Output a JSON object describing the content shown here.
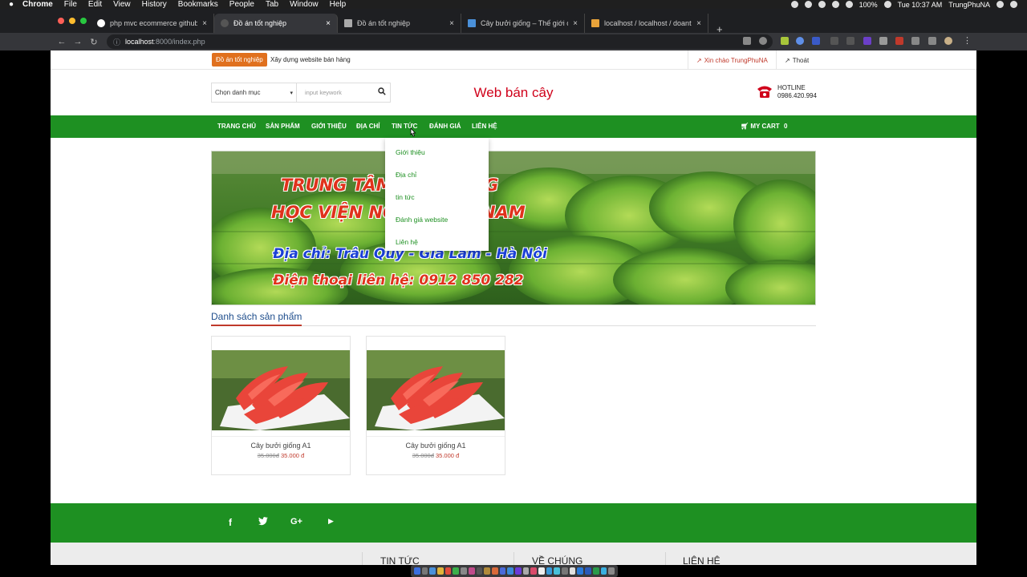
{
  "os_menu": {
    "apple": "",
    "items": [
      "Chrome",
      "File",
      "Edit",
      "View",
      "History",
      "Bookmarks",
      "People",
      "Tab",
      "Window",
      "Help"
    ],
    "battery": "100%",
    "clock": "Tue 10:37 AM",
    "user": "TrungPhuNA"
  },
  "browser": {
    "tabs": [
      {
        "label": "php mvc ecommerce github -",
        "close": "×"
      },
      {
        "label": "Đồ án tốt nghiệp",
        "close": "×"
      },
      {
        "label": "Đồ án tốt nghiệp",
        "close": "×"
      },
      {
        "label": "Cây bưởi giống – Thế giới cây",
        "close": "×"
      },
      {
        "label": "localhost / localhost / doantot",
        "close": "×"
      }
    ],
    "new_tab": "+",
    "url_host": "localhost",
    "url_path": ":8000/index.php",
    "back": "←",
    "forward": "→",
    "reload": "↻"
  },
  "site": {
    "topbar": {
      "badge": "Đồ án tốt nghiệp",
      "tagline": "Xây dựng website bán hàng",
      "greeting": "Xin chào TrungPhuNA",
      "logout": "Thoát"
    },
    "search": {
      "category_label": "Chọn danh mục",
      "placeholder": "input keywork"
    },
    "title": "Web bán cây",
    "hotline": {
      "label": "HOTLINE",
      "phone": "0986.420.994"
    },
    "nav": {
      "items": [
        "TRANG CHỦ",
        "SẢN PHẨM",
        "GIỚI THIỆU",
        "ĐỊA CHỈ",
        "TIN TỨC",
        "ĐÁNH GIÁ",
        "LIÊN HỆ"
      ],
      "cart_label": "MY CART",
      "cart_count": "0"
    },
    "dropdown": [
      "Giới thiệu",
      "Địa chỉ",
      "tin tức",
      "Đánh giá website",
      "Liên hệ"
    ],
    "banner": {
      "line1": "TRUNG TÂM GI",
      "line1b": "G",
      "line2": "HỌC VIỆN NÔNG",
      "line2b": "NAM",
      "line3": "Địa chỉ: Trâu Quỳ - Gia Lâm - Hà Nội",
      "line4": "Điện thoại liên hệ: 0912 850 282"
    },
    "section_title": "Danh sách sản phẩm",
    "products": [
      {
        "name": "Cây bưởi giống A1",
        "old_price": "35.000đ",
        "price": "35.000 đ"
      },
      {
        "name": "Cây bưởi giống A1",
        "old_price": "35.000đ",
        "price": "35.000 đ"
      }
    ],
    "social": [
      "f",
      "t",
      "G+",
      "▶"
    ],
    "footer_cols": [
      "TIN TỨC",
      "VỀ CHÚNG",
      "LIÊN HỆ"
    ]
  },
  "colors": {
    "brand_green": "#1e9022",
    "title_red": "#d0021b",
    "badge_orange": "#e0701e"
  }
}
